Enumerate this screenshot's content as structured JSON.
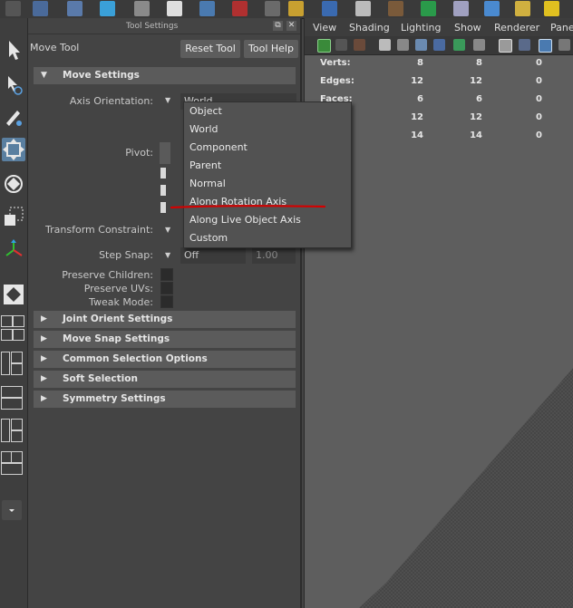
{
  "panel": {
    "title": "Tool Settings",
    "tool_name": "Move Tool",
    "reset_button": "Reset Tool",
    "help_button": "Tool Help",
    "float_glyph": "⧉",
    "close_glyph": "✕"
  },
  "sections": {
    "move_settings": "Move Settings",
    "joint_orient": "Joint Orient Settings",
    "move_snap": "Move Snap Settings",
    "common_selection": "Common Selection Options",
    "soft_selection": "Soft Selection",
    "symmetry": "Symmetry Settings"
  },
  "move_settings": {
    "axis_orientation_label": "Axis Orientation:",
    "axis_orientation_value": "World",
    "pivot_label": "Pivot:",
    "transform_constraint_label": "Transform Constraint:",
    "step_snap_label": "Step Snap:",
    "step_snap_value": "Off",
    "step_snap_amount": "1.00",
    "preserve_children_label": "Preserve Children:",
    "preserve_uvs_label": "Preserve UVs:",
    "tweak_mode_label": "Tweak Mode:"
  },
  "dropdown": {
    "options": [
      "Object",
      "World",
      "Component",
      "Parent",
      "Normal",
      "Along Rotation Axis",
      "Along Live Object Axis",
      "Custom"
    ],
    "annotation_color": "#d40000"
  },
  "viewport": {
    "menus": [
      "View",
      "Shading",
      "Lighting",
      "Show",
      "Renderer",
      "Panels"
    ],
    "hud": {
      "labels": [
        "Verts:",
        "Edges:",
        "Faces:",
        "",
        ""
      ],
      "col1": [
        "8",
        "12",
        "6",
        "12",
        "14"
      ],
      "col2": [
        "8",
        "12",
        "6",
        "12",
        "14"
      ],
      "col3": [
        "0",
        "0",
        "0",
        "0",
        "0"
      ]
    }
  },
  "colors": {
    "active_tool": "#5a7fa0",
    "panel_bg": "#444444",
    "section_header": "#5b5b5b",
    "viewport_bg": "#5e5e5e"
  }
}
